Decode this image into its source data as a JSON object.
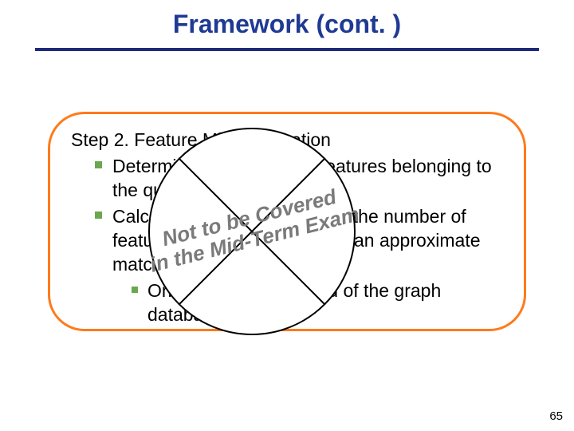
{
  "title": "Framework (cont. )",
  "step": {
    "heading": "Step 2. Feature Miss Estimation",
    "items": [
      {
        "text": "Determine the number of features belonging to the query graph"
      },
      {
        "text": "Calculate the upper bound of the number of features missed in graphs for an approximate matching, denoted by J",
        "children": [
          {
            "text": "On the features instead of the graph database"
          }
        ]
      }
    ]
  },
  "overlay_note_line1": "Not to be Covered",
  "overlay_note_line2": "in the Mid-Term Exam",
  "page_number": "65"
}
